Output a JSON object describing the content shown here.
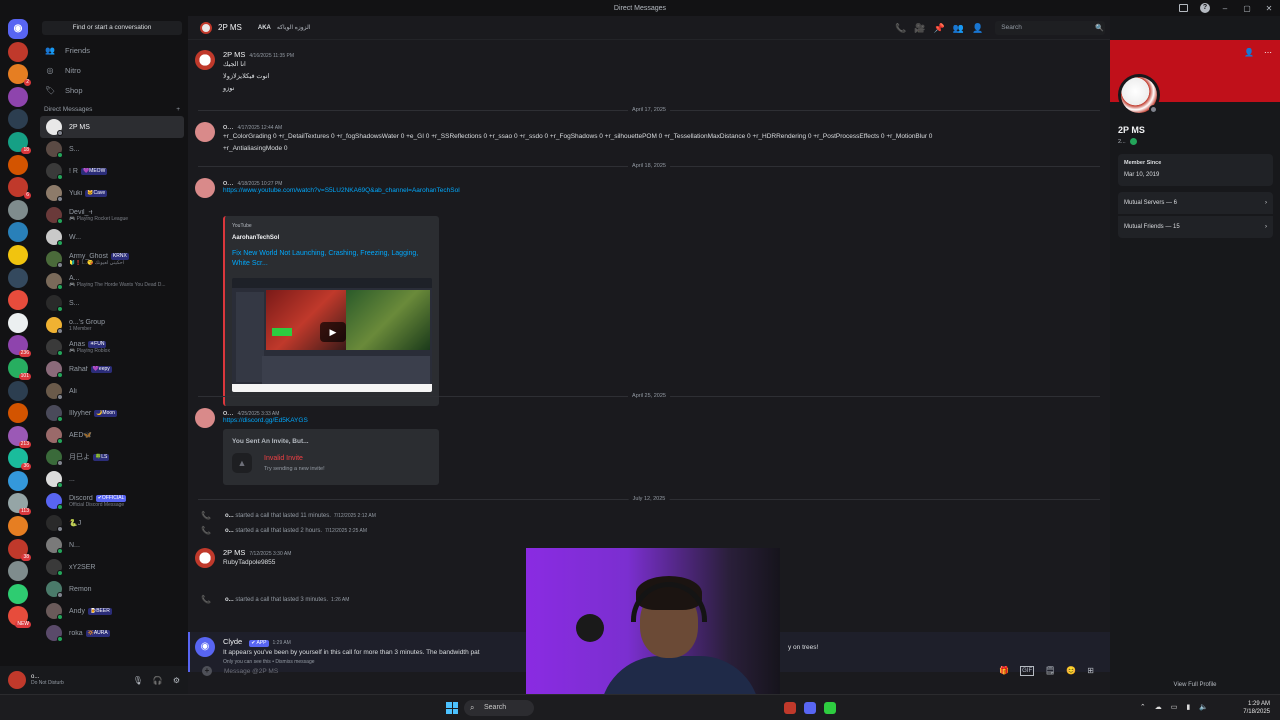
{
  "window": {
    "title": "Direct Messages",
    "controls": [
      "–",
      "▢",
      "✕"
    ]
  },
  "sidebar": {
    "find_placeholder": "Find or start a conversation",
    "nav": [
      {
        "label": "Friends",
        "icon": "friends-icon"
      },
      {
        "label": "Nitro",
        "icon": "nitro-icon"
      },
      {
        "label": "Shop",
        "icon": "shop-icon"
      }
    ],
    "dm_header": "Direct Messages",
    "dm_add": "+",
    "dms": [
      {
        "name": "2P MS",
        "sub": "",
        "tag": "",
        "color": "#e8e8e8",
        "active": true
      },
      {
        "name": "S...",
        "sub": "",
        "tag": "",
        "color": "#5a4a44"
      },
      {
        "name": "! R",
        "sub": "",
        "tag": "💜MEOW",
        "color": "#3a3a3a"
      },
      {
        "name": "Yuki",
        "sub": "",
        "tag": "🐱Cave",
        "color": "#8d7b6a"
      },
      {
        "name": "Devil_-ᵻ",
        "sub": "🎮 Playing Rocket League",
        "tag": "",
        "color": "#6a3a3a"
      },
      {
        "name": "W...",
        "sub": "",
        "tag": "",
        "color": "#c9c9c9"
      },
      {
        "name": "Army_Ghost",
        "sub": "🔰❗I...😘 احكيني لعيونك",
        "tag": "KRNX",
        "color": "#4a6a3a"
      },
      {
        "name": "A...",
        "sub": "🎮 Playing The Horde Wants You Dead D...",
        "tag": "",
        "color": "#7a6a5a"
      },
      {
        "name": "S...",
        "sub": "",
        "tag": "",
        "color": "#2a2a2a"
      },
      {
        "name": "o...'s Group",
        "sub": "1 Member",
        "tag": "",
        "color": "#f0b232"
      },
      {
        "name": "Anas",
        "sub": "🎮 Playing Roblox",
        "tag": "✳FUN",
        "color": "#3a3a3a"
      },
      {
        "name": "Rahaf",
        "sub": "",
        "tag": "💜eepy",
        "color": "#8a6a7a"
      },
      {
        "name": "Ali",
        "sub": "",
        "tag": "",
        "color": "#6a5a4a"
      },
      {
        "name": "Illyyher",
        "sub": "",
        "tag": "🌙Moon",
        "color": "#4a4a5a"
      },
      {
        "name": "AED🦋",
        "sub": "",
        "tag": "",
        "color": "#9a6a6a"
      },
      {
        "name": "月巳よ",
        "sub": "",
        "tag": "🍀LS",
        "color": "#3a6a3a"
      },
      {
        "name": "...",
        "sub": "",
        "tag": "",
        "color": "#dcdcdc"
      },
      {
        "name": "Discord",
        "sub": "Official Discord Message",
        "tag": "✔OFFICIAL",
        "color": "#5865f2"
      },
      {
        "name": "🐍J",
        "sub": "",
        "tag": "",
        "color": "#2a2a2a"
      },
      {
        "name": "N...",
        "sub": "",
        "tag": "",
        "color": "#7a7a7a"
      },
      {
        "name": "xY2SER",
        "sub": "",
        "tag": "",
        "color": "#3a3a3a"
      },
      {
        "name": "Remon",
        "sub": "",
        "tag": "",
        "color": "#4a7a6a"
      },
      {
        "name": "Andy",
        "sub": "",
        "tag": "🍺BEER",
        "color": "#6a5a5a"
      },
      {
        "name": "roka",
        "sub": "",
        "tag": "🔆AURA",
        "color": "#5a4a6a"
      }
    ]
  },
  "servers": [
    {
      "color": "#c0392b",
      "badge": ""
    },
    {
      "color": "#e67e22",
      "badge": "2"
    },
    {
      "color": "#8e44ad",
      "badge": ""
    },
    {
      "color": "#2c3e50",
      "badge": ""
    },
    {
      "color": "#16a085",
      "badge": "18"
    },
    {
      "color": "#d35400",
      "badge": ""
    },
    {
      "color": "#c0392b",
      "badge": "6"
    },
    {
      "color": "#7f8c8d",
      "badge": ""
    },
    {
      "color": "#2980b9",
      "badge": ""
    },
    {
      "color": "#f1c40f",
      "badge": ""
    },
    {
      "color": "#34495e",
      "badge": ""
    },
    {
      "color": "#e74c3c",
      "badge": ""
    },
    {
      "color": "#ecf0f1",
      "badge": ""
    },
    {
      "color": "#8e44ad",
      "badge": "236"
    },
    {
      "color": "#27ae60",
      "badge": "101"
    },
    {
      "color": "#2c3e50",
      "badge": ""
    },
    {
      "color": "#d35400",
      "badge": ""
    },
    {
      "color": "#9b59b6",
      "badge": "213"
    },
    {
      "color": "#1abc9c",
      "badge": "36"
    },
    {
      "color": "#3498db",
      "badge": ""
    },
    {
      "color": "#95a5a6",
      "badge": "113"
    },
    {
      "color": "#e67e22",
      "badge": ""
    },
    {
      "color": "#c0392b",
      "badge": "38"
    },
    {
      "color": "#7f8c8d",
      "badge": ""
    },
    {
      "color": "#2ecc71",
      "badge": ""
    },
    {
      "color": "#e74c3c",
      "badge": "NEW"
    }
  ],
  "user": {
    "name": "o...",
    "status": "Do Not Disturb",
    "controls": [
      "🎙",
      "🎧",
      "⚙"
    ]
  },
  "chat": {
    "name": "2P MS",
    "aka_label": "AKA",
    "aka_value": "الزوزه الوياكه",
    "tools": [
      "📞",
      "🎥",
      "📌",
      "👥",
      "👤"
    ],
    "search_placeholder": "Search",
    "messages": {
      "m1": {
        "author": "2P MS",
        "time": "4/16/2025 11:35 PM",
        "lines": [
          "انا الجيك",
          "انوت فيكلايزلازولا",
          "نوزو"
        ]
      },
      "d1": "April 17, 2025",
      "m2": {
        "author": "o...",
        "time": "4/17/2025 12:44 AM",
        "lines": [
          "+r_ColorGrading 0 +r_DetailTextures 0 +r_fogShadowsWater 0 +e_GI 0 +r_SSReflections 0 +r_ssao 0 +r_ssdo 0 +r_FogShadows 0 +r_silhouettePOM 0 +r_TessellationMaxDistance 0 +r_HDRRendering 0 +r_PostProcessEffects 0 +r_MotionBlur 0",
          "+r_AntialiasingMode 0"
        ]
      },
      "d2": "April 18, 2025",
      "m3": {
        "author": "o...",
        "time": "4/18/2025 10:27 PM",
        "link": "https://www.youtube.com/watch?v=S5LU2NKA69Q&ab_channel=AarohanTechSol"
      },
      "embed": {
        "provider": "YouTube",
        "author": "AarohanTechSol",
        "title": "Fix New World Not Launching, Crashing, Freezing, Lagging, White Scr..."
      },
      "d3": "April 25, 2025",
      "m4": {
        "author": "o...",
        "time": "4/25/2025 3:33 AM",
        "link": "https://discord.gg/Ed5KAYGS"
      },
      "invite": {
        "heading": "You Sent An Invite, But...",
        "title": "Invalid Invite",
        "sub": "Try sending a new invite!"
      },
      "d4": "July 12, 2025",
      "c1": {
        "user": "o...",
        "text": "started a call that lasted 11 minutes.",
        "time": "7/12/2025 2:12 AM"
      },
      "c2": {
        "user": "o...",
        "text": "started a call that lasted 2 hours.",
        "time": "7/12/2025 2:25 AM"
      },
      "m5": {
        "author": "2P MS",
        "time": "7/12/2025 3:30 AM",
        "lines": [
          "RubyTadpole9855"
        ]
      },
      "c3": {
        "user": "o...",
        "text": "started a call that lasted 3 minutes.",
        "time": "1:26 AM"
      },
      "clyde": {
        "author": "Clyde",
        "tag": "✔ APP",
        "time": "1:29 AM",
        "text": "It appears you've been by yourself in this call for more than 3 minutes. The bandwidth pat",
        "text_tail": "y on trees!",
        "note": "Only you can see this • Dismiss message"
      }
    },
    "composer_placeholder": "Message @2P MS",
    "composer_icons": [
      "🎁",
      "GIF",
      "🗒",
      "😊",
      "⊞"
    ]
  },
  "profile": {
    "name": "2P MS",
    "sub": "2...",
    "member_since_label": "Member Since",
    "member_since": "Mar 10, 2019",
    "mutual_servers": "Mutual Servers — 6",
    "mutual_friends": "Mutual Friends — 15",
    "view_full": "View Full Profile",
    "banner_color": "#c0101a"
  },
  "taskbar": {
    "search": "Search",
    "time": "1:29 AM",
    "date": "7/18/2025"
  }
}
